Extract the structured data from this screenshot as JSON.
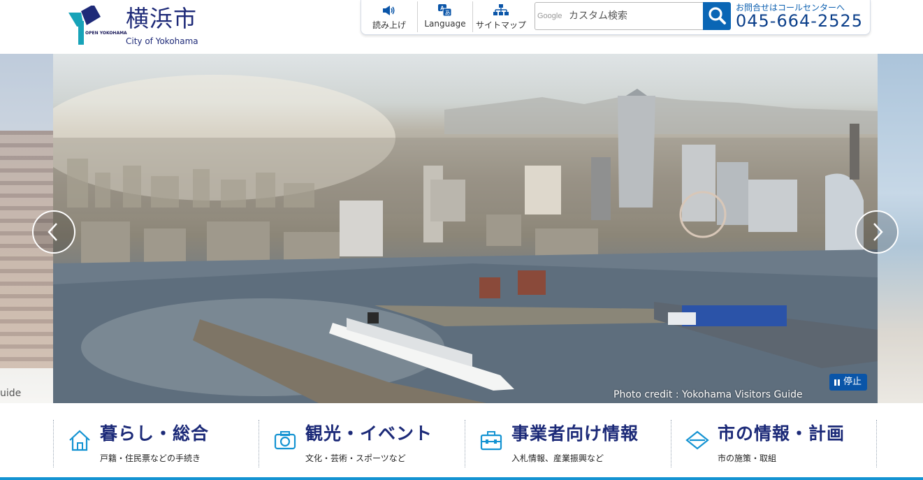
{
  "header": {
    "logo_mark": "OPEN YOKOHAMA",
    "logo_jp": "横浜市",
    "logo_en": "City of Yokohama",
    "tools": [
      {
        "label": "読み上げ",
        "icon": "speaker-icon"
      },
      {
        "label": "Language",
        "icon": "language-icon"
      },
      {
        "label": "サイトマップ",
        "icon": "sitemap-icon"
      }
    ],
    "search": {
      "provider": "Google",
      "placeholder": "カスタム検索",
      "icon": "search-icon"
    },
    "contact": {
      "label": "お問合せはコールセンターへ",
      "phone": "045-664-2525"
    }
  },
  "slider": {
    "credit": "Photo credit : Yokohama Visitors Guide",
    "pause_label": "停止",
    "side_left_text": "uide",
    "prev_icon": "chevron-left-icon",
    "next_icon": "chevron-right-icon"
  },
  "categories": [
    {
      "title": "暮らし・総合",
      "sub": "戸籍・住民票などの手続き",
      "icon": "house-icon"
    },
    {
      "title": "観光・イベント",
      "sub": "文化・芸術・スポーツなど",
      "icon": "camera-icon"
    },
    {
      "title": "事業者向け情報",
      "sub": "入札情報、産業振興など",
      "icon": "briefcase-icon"
    },
    {
      "title": "市の情報・計画",
      "sub": "市の施策・取組",
      "icon": "diamond-icon"
    }
  ],
  "colors": {
    "brand_navy": "#1c2a78",
    "accent_blue": "#0a66b5",
    "bottom_bar": "#1493d2"
  }
}
